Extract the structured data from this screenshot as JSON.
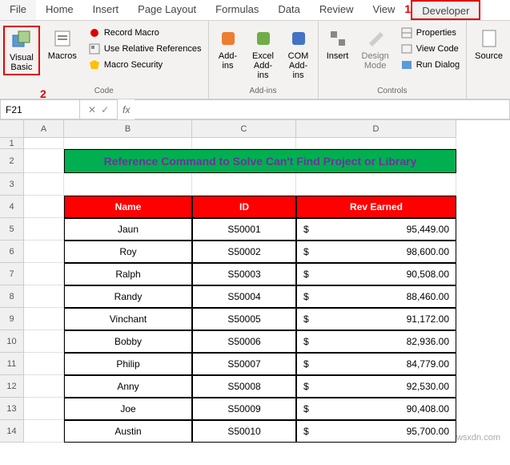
{
  "ribbon": {
    "tabs": [
      "File",
      "Home",
      "Insert",
      "Page Layout",
      "Formulas",
      "Data",
      "Review",
      "View",
      "Developer"
    ],
    "active_tab": "Developer",
    "annotations": {
      "developer": "1",
      "visual_basic": "2"
    },
    "groups": {
      "code": {
        "label": "Code",
        "visual_basic": "Visual\nBasic",
        "macros": "Macros",
        "record_macro": "Record Macro",
        "relative_refs": "Use Relative References",
        "macro_security": "Macro Security"
      },
      "addins": {
        "label": "Add-ins",
        "addins": "Add-\nins",
        "excel_addins": "Excel\nAdd-ins",
        "com_addins": "COM\nAdd-ins"
      },
      "controls": {
        "label": "Controls",
        "insert": "Insert",
        "design_mode": "Design\nMode",
        "properties": "Properties",
        "view_code": "View Code",
        "run_dialog": "Run Dialog"
      },
      "xml": {
        "source": "Source"
      }
    }
  },
  "namebox": {
    "ref": "F21",
    "fx": "fx"
  },
  "columns": [
    "A",
    "B",
    "C",
    "D"
  ],
  "sheet": {
    "title": "Reference Command to Solve Can't Find Project or Library",
    "headers": {
      "name": "Name",
      "id": "ID",
      "rev": "Rev Earned"
    },
    "currency": "$",
    "rows": [
      {
        "name": "Jaun",
        "id": "S50001",
        "rev": "95,449.00"
      },
      {
        "name": "Roy",
        "id": "S50002",
        "rev": "98,600.00"
      },
      {
        "name": "Ralph",
        "id": "S50003",
        "rev": "90,508.00"
      },
      {
        "name": "Randy",
        "id": "S50004",
        "rev": "88,460.00"
      },
      {
        "name": "Vinchant",
        "id": "S50005",
        "rev": "91,172.00"
      },
      {
        "name": "Bobby",
        "id": "S50006",
        "rev": "82,936.00"
      },
      {
        "name": "Philip",
        "id": "S50007",
        "rev": "84,779.00"
      },
      {
        "name": "Anny",
        "id": "S50008",
        "rev": "92,530.00"
      },
      {
        "name": "Joe",
        "id": "S50009",
        "rev": "90,408.00"
      },
      {
        "name": "Austin",
        "id": "S50010",
        "rev": "95,700.00"
      }
    ]
  },
  "watermark": "wsxdn.com",
  "chart_data": {
    "type": "table",
    "title": "Reference Command to Solve Can't Find Project or Library",
    "columns": [
      "Name",
      "ID",
      "Rev Earned"
    ],
    "rows": [
      [
        "Jaun",
        "S50001",
        95449.0
      ],
      [
        "Roy",
        "S50002",
        98600.0
      ],
      [
        "Ralph",
        "S50003",
        90508.0
      ],
      [
        "Randy",
        "S50004",
        88460.0
      ],
      [
        "Vinchant",
        "S50005",
        91172.0
      ],
      [
        "Bobby",
        "S50006",
        82936.0
      ],
      [
        "Philip",
        "S50007",
        84779.0
      ],
      [
        "Anny",
        "S50008",
        92530.0
      ],
      [
        "Joe",
        "S50009",
        90408.0
      ],
      [
        "Austin",
        "S50010",
        95700.0
      ]
    ]
  }
}
